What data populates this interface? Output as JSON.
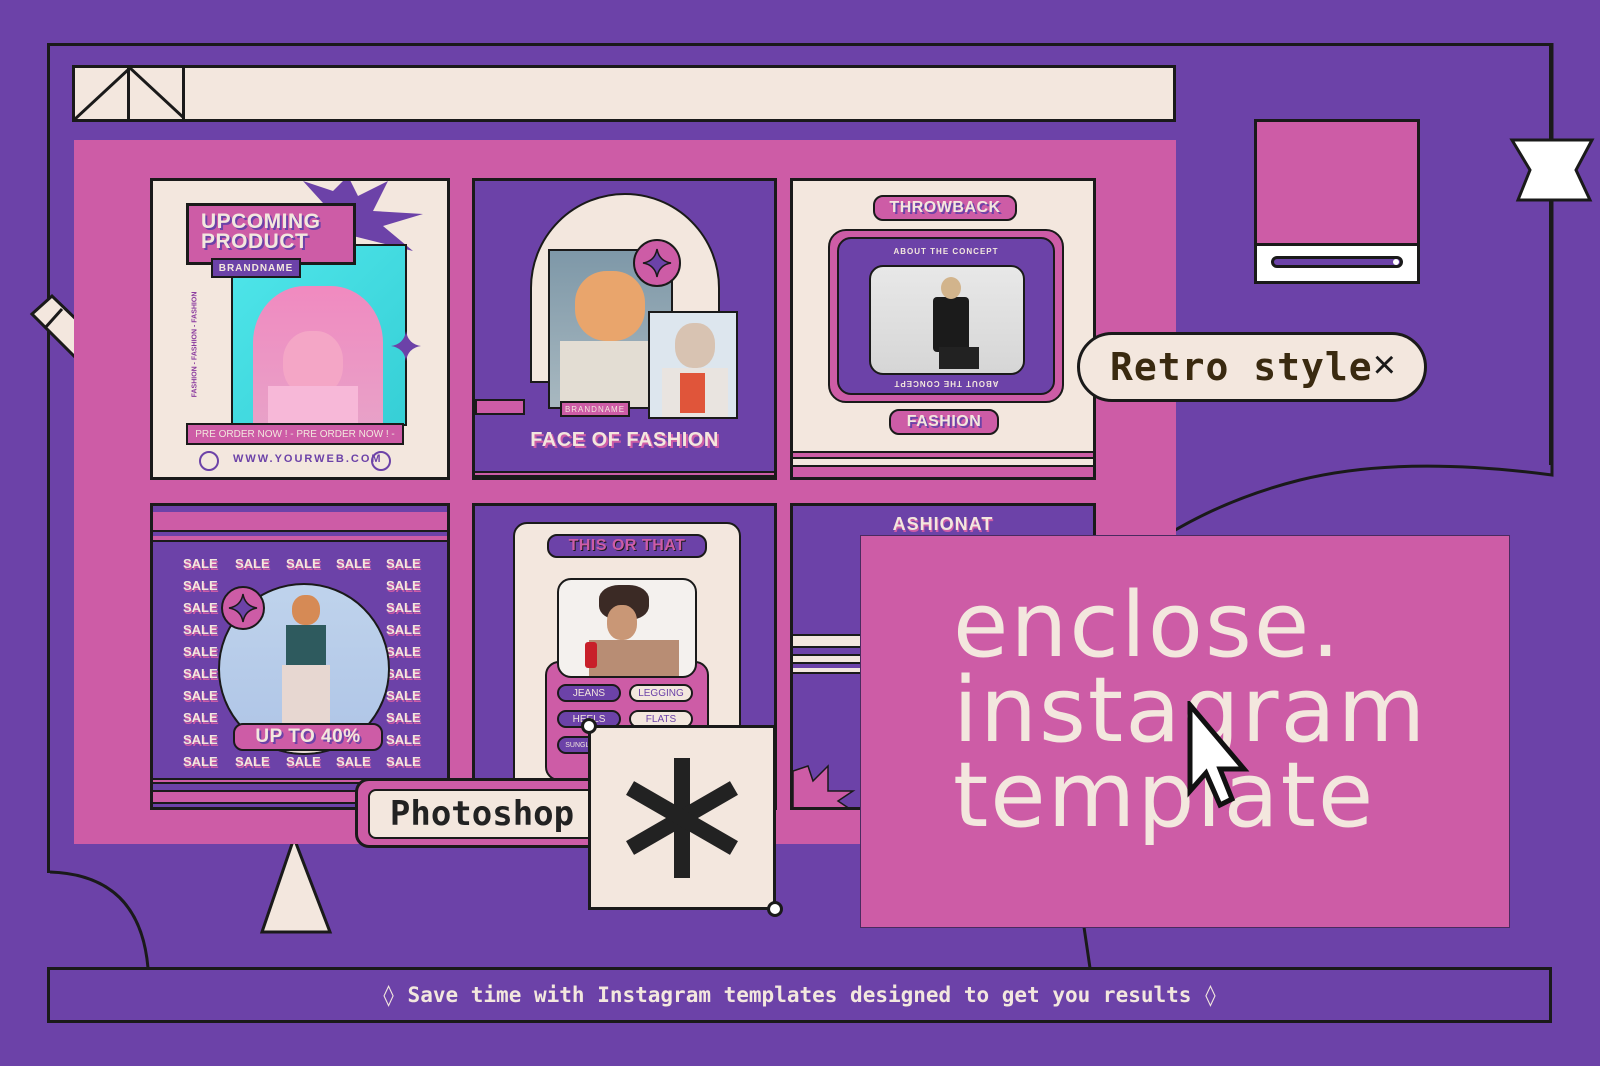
{
  "colors": {
    "background": "#6c42a8",
    "accent_pink": "#cd5ca6",
    "cream": "#f3e7de",
    "ink": "#1a1a1a"
  },
  "cards": {
    "upcoming": {
      "title_line1": "UPCOMING",
      "title_line2": "PRODUCT",
      "brand": "BRANDNAME",
      "side_text": "FASHION - FASHION - FASHION",
      "banner": "PRE ORDER NOW ! - PRE ORDER NOW ! -",
      "website": "WWW.YOURWEB.COM"
    },
    "face_of_fashion": {
      "brand": "BRANDNAME",
      "title": "FACE OF FASHION"
    },
    "throwback": {
      "title": "THROWBACK",
      "caption_top": "ABOUT THE CONCEPT",
      "caption_bottom": "ABOUT THE CONCEPT",
      "label": "FASHION"
    },
    "sale": {
      "word": "SALE",
      "badge": "UP TO 40%"
    },
    "this_or_that": {
      "title": "THIS OR THAT",
      "options": [
        "JEANS",
        "LEGGING",
        "HEELS",
        "FLATS",
        "SUNGLASSES"
      ]
    },
    "fashionista": {
      "arc_text": "ASHIONAT"
    }
  },
  "tags": {
    "retro": "Retro style",
    "retro_close": "×",
    "photoshop": "Photoshop"
  },
  "hero": {
    "line1": "enclose.",
    "line2": "instagram",
    "line3": "template"
  },
  "footer": {
    "text": "◊ Save time with Instagram templates designed to get you results ◊"
  }
}
